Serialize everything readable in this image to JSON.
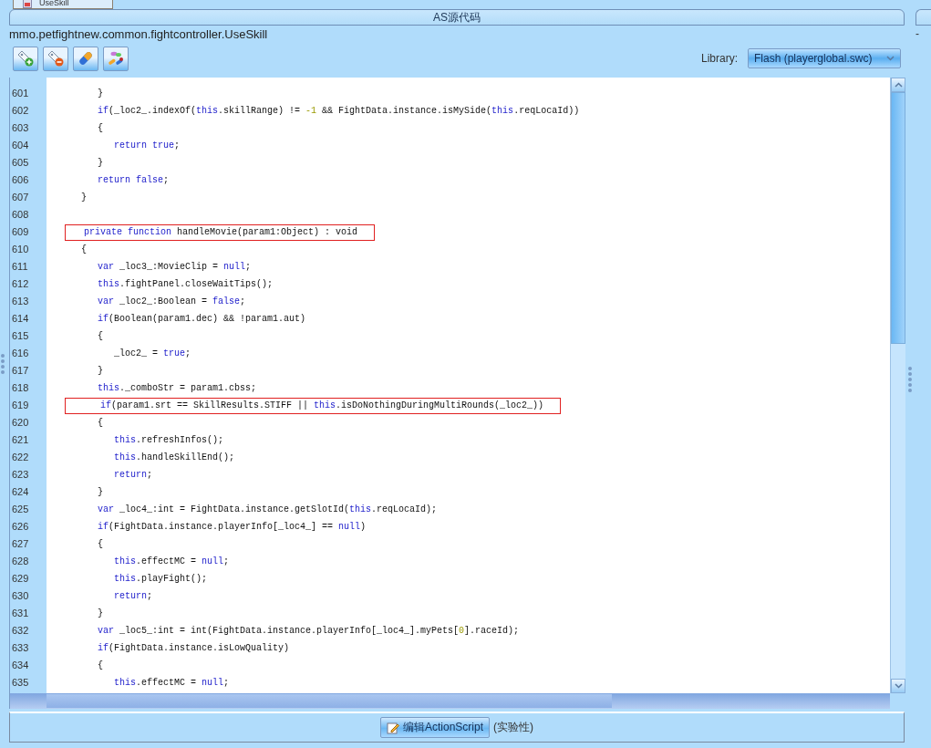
{
  "top_tab": {
    "label": "UseSkill"
  },
  "panel_title": "AS源代码",
  "side_mark": "-",
  "class_path": "mmo.petfightnew.common.fightcontroller.UseSkill",
  "toolbar": {
    "buttons": [
      {
        "kind": "tag-add"
      },
      {
        "kind": "tag-remove"
      },
      {
        "kind": "capsule"
      },
      {
        "kind": "pills"
      }
    ],
    "library_label": "Library:",
    "library_value": "Flash (playerglobal.swc)"
  },
  "code": {
    "lines": [
      {
        "number": "601",
        "tokens": [
          {
            "kind": "text",
            "text": "      }"
          }
        ]
      },
      {
        "number": "602",
        "tokens": [
          {
            "kind": "kw",
            "text": "      if"
          },
          {
            "kind": "text",
            "text": "(_loc2_.indexOf("
          },
          {
            "kind": "kw",
            "text": "this"
          },
          {
            "kind": "text",
            "text": ".skillRange) != "
          },
          {
            "kind": "num",
            "text": "-1"
          },
          {
            "kind": "text",
            "text": " && FightData.instance.isMySide("
          },
          {
            "kind": "kw",
            "text": "this"
          },
          {
            "kind": "text",
            "text": ".reqLocaId))"
          }
        ]
      },
      {
        "number": "603",
        "tokens": [
          {
            "kind": "text",
            "text": "      {"
          }
        ]
      },
      {
        "number": "604",
        "tokens": [
          {
            "kind": "kw",
            "text": "         return true"
          },
          {
            "kind": "text",
            "text": ";"
          }
        ]
      },
      {
        "number": "605",
        "tokens": [
          {
            "kind": "text",
            "text": "      }"
          }
        ]
      },
      {
        "number": "606",
        "tokens": [
          {
            "kind": "kw",
            "text": "      return false"
          },
          {
            "kind": "text",
            "text": ";"
          }
        ]
      },
      {
        "number": "607",
        "tokens": [
          {
            "kind": "text",
            "text": "   }"
          }
        ]
      },
      {
        "number": "608"
      },
      {
        "number": "609",
        "boxed": true,
        "tokens": [
          {
            "kind": "kw",
            "text": "   private function"
          },
          {
            "kind": "text",
            "text": " handleMovie(param1:Object) : void"
          }
        ]
      },
      {
        "number": "610",
        "tokens": [
          {
            "kind": "text",
            "text": "   {"
          }
        ]
      },
      {
        "number": "611",
        "tokens": [
          {
            "kind": "kw",
            "text": "      var"
          },
          {
            "kind": "text",
            "text": " _loc3_:MovieClip = "
          },
          {
            "kind": "kw",
            "text": "null"
          },
          {
            "kind": "text",
            "text": ";"
          }
        ]
      },
      {
        "number": "612",
        "tokens": [
          {
            "kind": "kw",
            "text": "      this"
          },
          {
            "kind": "text",
            "text": ".fightPanel.closeWaitTips();"
          }
        ]
      },
      {
        "number": "613",
        "tokens": [
          {
            "kind": "kw",
            "text": "      var"
          },
          {
            "kind": "text",
            "text": " _loc2_:Boolean = "
          },
          {
            "kind": "kw",
            "text": "false"
          },
          {
            "kind": "text",
            "text": ";"
          }
        ]
      },
      {
        "number": "614",
        "tokens": [
          {
            "kind": "kw",
            "text": "      if"
          },
          {
            "kind": "text",
            "text": "(Boolean(param1.dec) && !param1.aut)"
          }
        ]
      },
      {
        "number": "615",
        "tokens": [
          {
            "kind": "text",
            "text": "      {"
          }
        ]
      },
      {
        "number": "616",
        "tokens": [
          {
            "kind": "text",
            "text": "         _loc2_ = "
          },
          {
            "kind": "kw",
            "text": "true"
          },
          {
            "kind": "text",
            "text": ";"
          }
        ]
      },
      {
        "number": "617",
        "tokens": [
          {
            "kind": "text",
            "text": "      }"
          }
        ]
      },
      {
        "number": "618",
        "tokens": [
          {
            "kind": "kw",
            "text": "      this"
          },
          {
            "kind": "text",
            "text": "._comboStr = param1.cbss;"
          }
        ]
      },
      {
        "number": "619",
        "boxed": true,
        "tokens": [
          {
            "kind": "kw",
            "text": "      if"
          },
          {
            "kind": "text",
            "text": "(param1.srt == SkillResults.STIFF || "
          },
          {
            "kind": "kw",
            "text": "this"
          },
          {
            "kind": "text",
            "text": ".isDoNothingDuringMultiRounds(_loc2_))"
          }
        ]
      },
      {
        "number": "620",
        "tokens": [
          {
            "kind": "text",
            "text": "      {"
          }
        ]
      },
      {
        "number": "621",
        "tokens": [
          {
            "kind": "kw",
            "text": "         this"
          },
          {
            "kind": "text",
            "text": ".refreshInfos();"
          }
        ]
      },
      {
        "number": "622",
        "tokens": [
          {
            "kind": "kw",
            "text": "         this"
          },
          {
            "kind": "text",
            "text": ".handleSkillEnd();"
          }
        ]
      },
      {
        "number": "623",
        "tokens": [
          {
            "kind": "kw",
            "text": "         return"
          },
          {
            "kind": "text",
            "text": ";"
          }
        ]
      },
      {
        "number": "624",
        "tokens": [
          {
            "kind": "text",
            "text": "      }"
          }
        ]
      },
      {
        "number": "625",
        "tokens": [
          {
            "kind": "kw",
            "text": "      var"
          },
          {
            "kind": "text",
            "text": " _loc4_:int = FightData.instance.getSlotId("
          },
          {
            "kind": "kw",
            "text": "this"
          },
          {
            "kind": "text",
            "text": ".reqLocaId);"
          }
        ]
      },
      {
        "number": "626",
        "tokens": [
          {
            "kind": "kw",
            "text": "      if"
          },
          {
            "kind": "text",
            "text": "(FightData.instance.playerInfo[_loc4_] == "
          },
          {
            "kind": "kw",
            "text": "null"
          },
          {
            "kind": "text",
            "text": ")"
          }
        ]
      },
      {
        "number": "627",
        "tokens": [
          {
            "kind": "text",
            "text": "      {"
          }
        ]
      },
      {
        "number": "628",
        "tokens": [
          {
            "kind": "kw",
            "text": "         this"
          },
          {
            "kind": "text",
            "text": ".effectMC = "
          },
          {
            "kind": "kw",
            "text": "null"
          },
          {
            "kind": "text",
            "text": ";"
          }
        ]
      },
      {
        "number": "629",
        "tokens": [
          {
            "kind": "kw",
            "text": "         this"
          },
          {
            "kind": "text",
            "text": ".playFight();"
          }
        ]
      },
      {
        "number": "630",
        "tokens": [
          {
            "kind": "kw",
            "text": "         return"
          },
          {
            "kind": "text",
            "text": ";"
          }
        ]
      },
      {
        "number": "631",
        "tokens": [
          {
            "kind": "text",
            "text": "      }"
          }
        ]
      },
      {
        "number": "632",
        "tokens": [
          {
            "kind": "kw",
            "text": "      var"
          },
          {
            "kind": "text",
            "text": " _loc5_:int = int(FightData.instance.playerInfo[_loc4_].myPets["
          },
          {
            "kind": "num",
            "text": "0"
          },
          {
            "kind": "text",
            "text": "].raceId);"
          }
        ]
      },
      {
        "number": "633",
        "tokens": [
          {
            "kind": "kw",
            "text": "      if"
          },
          {
            "kind": "text",
            "text": "(FightData.instance.isLowQuality)"
          }
        ]
      },
      {
        "number": "634",
        "tokens": [
          {
            "kind": "text",
            "text": "      {"
          }
        ]
      },
      {
        "number": "635",
        "tokens": [
          {
            "kind": "kw",
            "text": "         this"
          },
          {
            "kind": "text",
            "text": ".effectMC = "
          },
          {
            "kind": "kw",
            "text": "null"
          },
          {
            "kind": "text",
            "text": ";"
          }
        ]
      }
    ]
  },
  "bottom": {
    "edit_button": "编辑ActionScript",
    "note": "(实验性)"
  }
}
